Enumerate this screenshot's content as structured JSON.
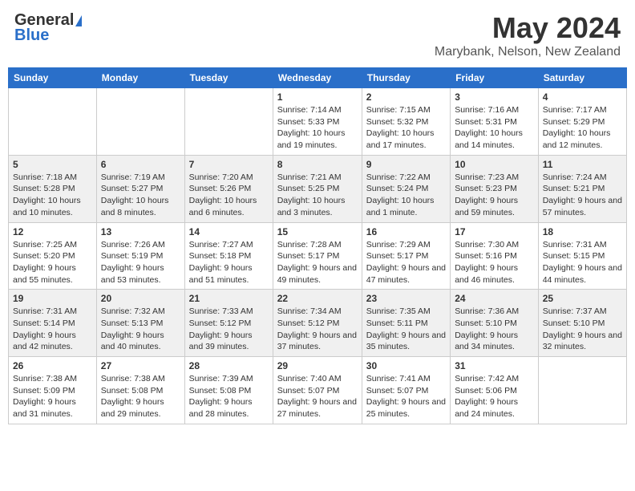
{
  "header": {
    "logo_general": "General",
    "logo_blue": "Blue",
    "month_title": "May 2024",
    "location": "Marybank, Nelson, New Zealand"
  },
  "weekdays": [
    "Sunday",
    "Monday",
    "Tuesday",
    "Wednesday",
    "Thursday",
    "Friday",
    "Saturday"
  ],
  "weeks": [
    [
      {
        "day": "",
        "sunrise": "",
        "sunset": "",
        "daylight": ""
      },
      {
        "day": "",
        "sunrise": "",
        "sunset": "",
        "daylight": ""
      },
      {
        "day": "",
        "sunrise": "",
        "sunset": "",
        "daylight": ""
      },
      {
        "day": "1",
        "sunrise": "Sunrise: 7:14 AM",
        "sunset": "Sunset: 5:33 PM",
        "daylight": "Daylight: 10 hours and 19 minutes."
      },
      {
        "day": "2",
        "sunrise": "Sunrise: 7:15 AM",
        "sunset": "Sunset: 5:32 PM",
        "daylight": "Daylight: 10 hours and 17 minutes."
      },
      {
        "day": "3",
        "sunrise": "Sunrise: 7:16 AM",
        "sunset": "Sunset: 5:31 PM",
        "daylight": "Daylight: 10 hours and 14 minutes."
      },
      {
        "day": "4",
        "sunrise": "Sunrise: 7:17 AM",
        "sunset": "Sunset: 5:29 PM",
        "daylight": "Daylight: 10 hours and 12 minutes."
      }
    ],
    [
      {
        "day": "5",
        "sunrise": "Sunrise: 7:18 AM",
        "sunset": "Sunset: 5:28 PM",
        "daylight": "Daylight: 10 hours and 10 minutes."
      },
      {
        "day": "6",
        "sunrise": "Sunrise: 7:19 AM",
        "sunset": "Sunset: 5:27 PM",
        "daylight": "Daylight: 10 hours and 8 minutes."
      },
      {
        "day": "7",
        "sunrise": "Sunrise: 7:20 AM",
        "sunset": "Sunset: 5:26 PM",
        "daylight": "Daylight: 10 hours and 6 minutes."
      },
      {
        "day": "8",
        "sunrise": "Sunrise: 7:21 AM",
        "sunset": "Sunset: 5:25 PM",
        "daylight": "Daylight: 10 hours and 3 minutes."
      },
      {
        "day": "9",
        "sunrise": "Sunrise: 7:22 AM",
        "sunset": "Sunset: 5:24 PM",
        "daylight": "Daylight: 10 hours and 1 minute."
      },
      {
        "day": "10",
        "sunrise": "Sunrise: 7:23 AM",
        "sunset": "Sunset: 5:23 PM",
        "daylight": "Daylight: 9 hours and 59 minutes."
      },
      {
        "day": "11",
        "sunrise": "Sunrise: 7:24 AM",
        "sunset": "Sunset: 5:21 PM",
        "daylight": "Daylight: 9 hours and 57 minutes."
      }
    ],
    [
      {
        "day": "12",
        "sunrise": "Sunrise: 7:25 AM",
        "sunset": "Sunset: 5:20 PM",
        "daylight": "Daylight: 9 hours and 55 minutes."
      },
      {
        "day": "13",
        "sunrise": "Sunrise: 7:26 AM",
        "sunset": "Sunset: 5:19 PM",
        "daylight": "Daylight: 9 hours and 53 minutes."
      },
      {
        "day": "14",
        "sunrise": "Sunrise: 7:27 AM",
        "sunset": "Sunset: 5:18 PM",
        "daylight": "Daylight: 9 hours and 51 minutes."
      },
      {
        "day": "15",
        "sunrise": "Sunrise: 7:28 AM",
        "sunset": "Sunset: 5:17 PM",
        "daylight": "Daylight: 9 hours and 49 minutes."
      },
      {
        "day": "16",
        "sunrise": "Sunrise: 7:29 AM",
        "sunset": "Sunset: 5:17 PM",
        "daylight": "Daylight: 9 hours and 47 minutes."
      },
      {
        "day": "17",
        "sunrise": "Sunrise: 7:30 AM",
        "sunset": "Sunset: 5:16 PM",
        "daylight": "Daylight: 9 hours and 46 minutes."
      },
      {
        "day": "18",
        "sunrise": "Sunrise: 7:31 AM",
        "sunset": "Sunset: 5:15 PM",
        "daylight": "Daylight: 9 hours and 44 minutes."
      }
    ],
    [
      {
        "day": "19",
        "sunrise": "Sunrise: 7:31 AM",
        "sunset": "Sunset: 5:14 PM",
        "daylight": "Daylight: 9 hours and 42 minutes."
      },
      {
        "day": "20",
        "sunrise": "Sunrise: 7:32 AM",
        "sunset": "Sunset: 5:13 PM",
        "daylight": "Daylight: 9 hours and 40 minutes."
      },
      {
        "day": "21",
        "sunrise": "Sunrise: 7:33 AM",
        "sunset": "Sunset: 5:12 PM",
        "daylight": "Daylight: 9 hours and 39 minutes."
      },
      {
        "day": "22",
        "sunrise": "Sunrise: 7:34 AM",
        "sunset": "Sunset: 5:12 PM",
        "daylight": "Daylight: 9 hours and 37 minutes."
      },
      {
        "day": "23",
        "sunrise": "Sunrise: 7:35 AM",
        "sunset": "Sunset: 5:11 PM",
        "daylight": "Daylight: 9 hours and 35 minutes."
      },
      {
        "day": "24",
        "sunrise": "Sunrise: 7:36 AM",
        "sunset": "Sunset: 5:10 PM",
        "daylight": "Daylight: 9 hours and 34 minutes."
      },
      {
        "day": "25",
        "sunrise": "Sunrise: 7:37 AM",
        "sunset": "Sunset: 5:10 PM",
        "daylight": "Daylight: 9 hours and 32 minutes."
      }
    ],
    [
      {
        "day": "26",
        "sunrise": "Sunrise: 7:38 AM",
        "sunset": "Sunset: 5:09 PM",
        "daylight": "Daylight: 9 hours and 31 minutes."
      },
      {
        "day": "27",
        "sunrise": "Sunrise: 7:38 AM",
        "sunset": "Sunset: 5:08 PM",
        "daylight": "Daylight: 9 hours and 29 minutes."
      },
      {
        "day": "28",
        "sunrise": "Sunrise: 7:39 AM",
        "sunset": "Sunset: 5:08 PM",
        "daylight": "Daylight: 9 hours and 28 minutes."
      },
      {
        "day": "29",
        "sunrise": "Sunrise: 7:40 AM",
        "sunset": "Sunset: 5:07 PM",
        "daylight": "Daylight: 9 hours and 27 minutes."
      },
      {
        "day": "30",
        "sunrise": "Sunrise: 7:41 AM",
        "sunset": "Sunset: 5:07 PM",
        "daylight": "Daylight: 9 hours and 25 minutes."
      },
      {
        "day": "31",
        "sunrise": "Sunrise: 7:42 AM",
        "sunset": "Sunset: 5:06 PM",
        "daylight": "Daylight: 9 hours and 24 minutes."
      },
      {
        "day": "",
        "sunrise": "",
        "sunset": "",
        "daylight": ""
      }
    ]
  ]
}
